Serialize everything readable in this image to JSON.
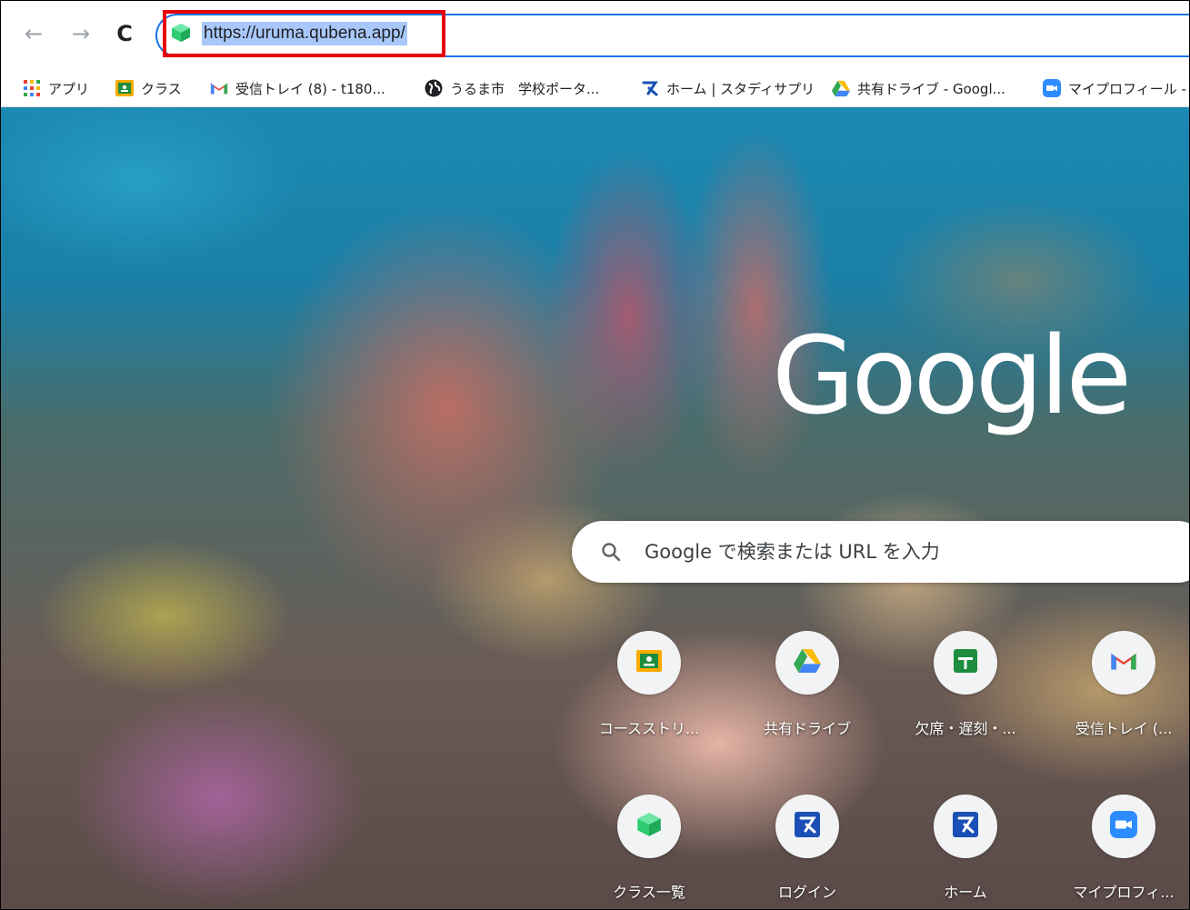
{
  "toolbar": {
    "back_label": "←",
    "forward_label": "→",
    "reload_label": "C",
    "url": "https://uruma.qubena.app/"
  },
  "bookmarks": [
    {
      "label": "アプリ",
      "icon": "apps-grid-icon"
    },
    {
      "label": "クラス",
      "icon": "google-classroom-icon"
    },
    {
      "label": "受信トレイ (8) - t180...",
      "icon": "gmail-icon"
    },
    {
      "label": "うるま市　学校ポータ...",
      "icon": "globe-icon"
    },
    {
      "label": "ホーム | スタディサプリ",
      "icon": "studysapuri-icon"
    },
    {
      "label": "共有ドライブ - Googl...",
      "icon": "google-drive-icon"
    },
    {
      "label": "マイプロフィール - ",
      "icon": "zoom-icon"
    }
  ],
  "page": {
    "logo": "Google",
    "search_placeholder": "Google で検索または URL を入力"
  },
  "shortcuts": [
    {
      "label": "コースストリ...",
      "icon": "google-classroom-icon"
    },
    {
      "label": "共有ドライブ",
      "icon": "google-drive-icon"
    },
    {
      "label": "欠席・遅刻・...",
      "icon": "google-sheets-icon"
    },
    {
      "label": "受信トレイ (...",
      "icon": "gmail-icon"
    },
    {
      "label": "クラス一覧",
      "icon": "qubena-icon"
    },
    {
      "label": "ログイン",
      "icon": "studysapuri-icon"
    },
    {
      "label": "ホーム",
      "icon": "studysapuri-icon"
    },
    {
      "label": "マイプロフィ...",
      "icon": "zoom-icon"
    }
  ],
  "colors": {
    "highlight": "#e8000b",
    "omnibox_focus": "#1a73e8",
    "url_selection": "#a8c7fa"
  }
}
